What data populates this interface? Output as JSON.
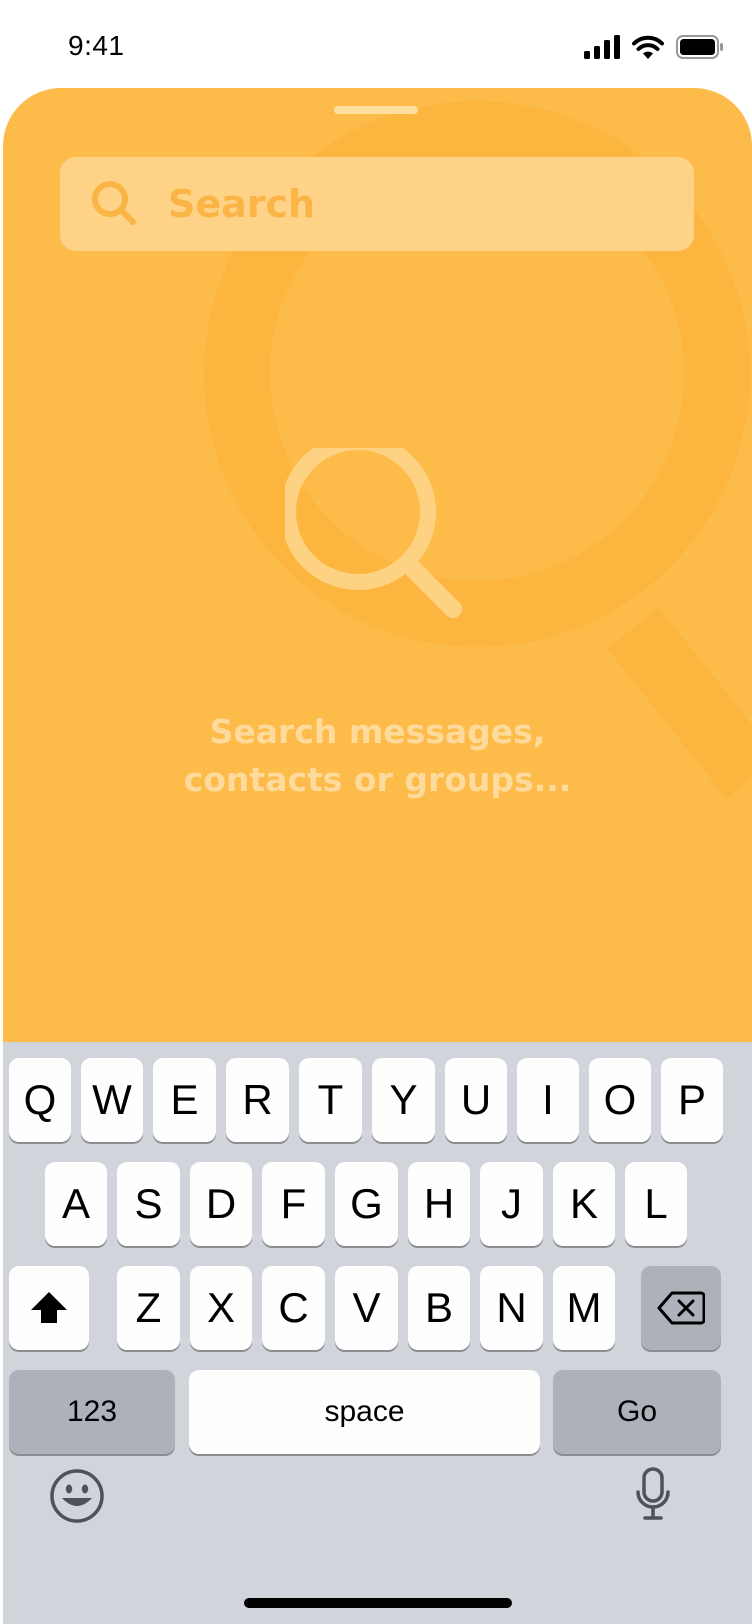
{
  "status_bar": {
    "time": "9:41"
  },
  "sheet": {
    "search": {
      "placeholder": "Search"
    },
    "empty_state": {
      "line1": "Search messages,",
      "line2": "contacts or groups..."
    }
  },
  "keyboard": {
    "row1": [
      "Q",
      "W",
      "E",
      "R",
      "T",
      "Y",
      "U",
      "I",
      "O",
      "P"
    ],
    "row2": [
      "A",
      "S",
      "D",
      "F",
      "G",
      "H",
      "J",
      "K",
      "L"
    ],
    "row3": [
      "Z",
      "X",
      "C",
      "V",
      "B",
      "N",
      "M"
    ],
    "numbers_label": "123",
    "space_label": "space",
    "go_label": "Go"
  },
  "colors": {
    "accent": "#FDBB4A",
    "search_field": "#FED387",
    "keyboard_bg": "#D1D4DB",
    "key": "#FEFEFE",
    "key_dark": "#ACB1BA"
  }
}
